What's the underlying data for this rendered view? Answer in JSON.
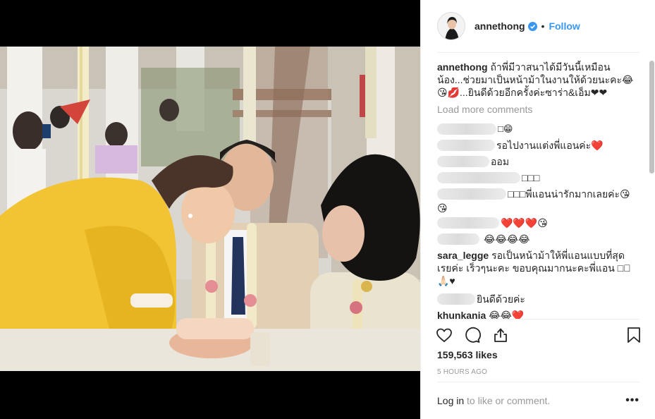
{
  "header": {
    "username": "annethong",
    "separator": "•",
    "follow_label": "Follow",
    "verified_icon": "verified-badge-icon"
  },
  "caption": {
    "username": "annethong",
    "text": "ถ้าพี่มีวาสนาได้มีวันนี้เหมือนน้อง...ช่วยมาเป็นหน้าม้าในงานให้ด้วยนะคะ😂😘💋...ยินดีด้วยอีกครั้งค่ะซาร่า&เอ็ม❤❤"
  },
  "load_more_label": "Load more comments",
  "comments": [
    {
      "text": " □😁"
    },
    {
      "text": "รอไปงานแต่งพี่แอนค่ะ❤️"
    },
    {
      "text": "ออม"
    },
    {
      "text": "□□□"
    },
    {
      "text": "□□□พี่แอนน่ารักมากเลยค่ะ😘"
    },
    {
      "text": "😘"
    },
    {
      "text": "❤️❤️❤️😘"
    },
    {
      "text": "😂😂😂😂"
    },
    {
      "username": "sara_legge",
      "text": "รอเป็นหน้าม้าให้พี่แอนแบบที่สุดเรยค่ะ เร็วๆนะคะ ขอบคุณมากนะคะพี่แอน □🏻🙏🏻♥"
    },
    {
      "text": "ยินดีด้วยค่ะ"
    },
    {
      "username": "khunkanja",
      "text": "😂😂❤️"
    }
  ],
  "actions": {
    "like_icon": "heart-icon",
    "comment_icon": "comment-icon",
    "share_icon": "share-icon",
    "save_icon": "bookmark-icon"
  },
  "likes_label": "159,563 likes",
  "timestamp": "5 HOURS AGO",
  "footer": {
    "login_link": "Log in",
    "login_rest": " to like or comment.",
    "more_label": "•••"
  },
  "colors": {
    "accent": "#3897f0",
    "text": "#262626",
    "muted": "#999999",
    "divider": "#efefef"
  }
}
